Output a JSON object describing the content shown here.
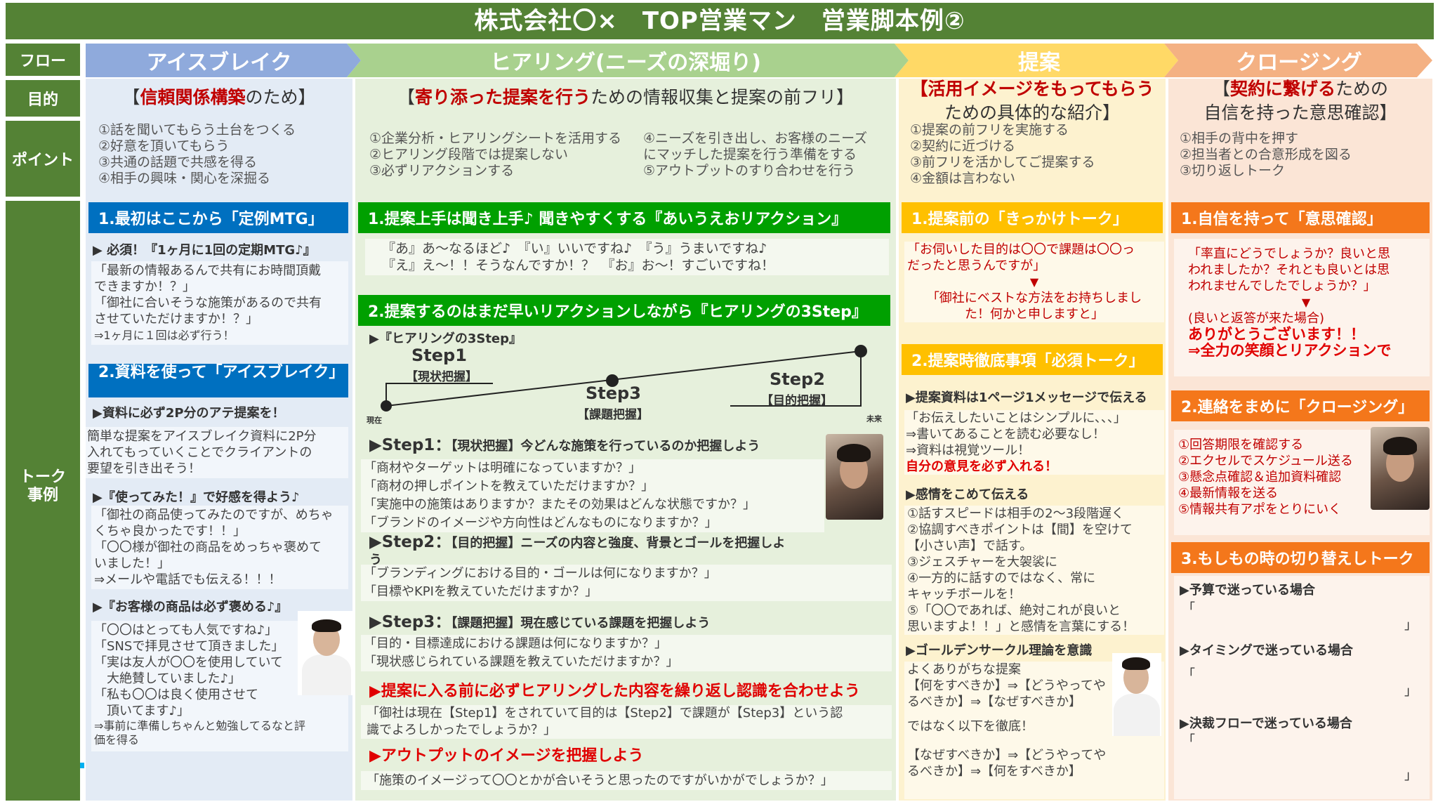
{
  "title": "株式会社〇×　TOP営業マン　営業脚本例②",
  "side_labels": {
    "flow": "フロー",
    "purpose": "目的",
    "point": "ポイント",
    "talk": "トーク\n事例"
  },
  "phases": [
    "アイスブレイク",
    "ヒアリング(ニーズの深堀り)",
    "提案",
    "クロージング"
  ],
  "purposes": {
    "ice": {
      "pre": "【",
      "red": "信頼関係構築",
      "post": "のため】"
    },
    "hear": {
      "pre": "【",
      "red": "寄り添った提案を行う",
      "post": "ための情報収集と提案の前フリ】"
    },
    "prop": {
      "red": "【活用イメージをもってもらう",
      "post": "ための具体的な紹介】"
    },
    "close": {
      "pre": "【",
      "red": "契約に繋げる",
      "post": "ための",
      "line2": "自信を持った意思確認】"
    }
  },
  "points": {
    "ice": [
      "①話を聞いてもらう土台をつくる",
      "②好意を頂いてもらう",
      "③共通の話題で共感を得る",
      "④相手の興味・関心を深掘る"
    ],
    "hear_a": [
      "①企業分析・ヒアリングシートを活用する",
      "②ヒアリング段階では提案しない",
      "③必ずリアクションする"
    ],
    "hear_b": [
      "④ニーズを引き出し、お客様のニーズ",
      "にマッチした提案を行う準備をする",
      "⑤アウトプットのすり合わせを行う"
    ],
    "prop": [
      "①提案の前フリを実施する",
      "②契約に近づける",
      "③前フリを活かしてご提案する",
      "④金額は言わない"
    ],
    "close": [
      "①相手の背中を押す",
      "②担当者との合意形成を図る",
      "③切り返しトーク"
    ]
  },
  "ice": {
    "h1": "1.最初はここから「定例MTG」",
    "s1": "▶ 必須！『1ヶ月に1回の定期MTG♪』",
    "t1": [
      "「最新の情報あるんで共有にお時間頂戴",
      "できますか！？」",
      "「御社に合いそうな施策があるので共有",
      "させていただけますか！？」"
    ],
    "t1b": "⇒1ヶ月に１回は必ず行う！",
    "h2": "2.資料を使って「アイスブレイク」",
    "s2": "▶資料に必ず2P分のアテ提案を！",
    "t2": [
      "簡単な提案をアイスブレイク資料に2P分",
      "入れてもっていくことでクライアントの",
      "要望を引き出そう！"
    ],
    "s3": "▶『使ってみた！』で好感を得よう♪",
    "t3": [
      "「御社の商品使ってみたのですが、めちゃ",
      "くちゃ良かったです！！」",
      "「〇〇様が御社の商品をめっちゃ褒めて",
      "いました！」",
      "⇒メールや電話でも伝える！！！"
    ],
    "s4": "▶『お客様の商品は必ず褒める♪』",
    "t4": [
      "「〇〇はとっても人気ですね♪」",
      "「SNSで拝見させて頂きました」",
      "「実は友人が〇〇を使用していて",
      "　大絶賛していました♪」",
      "「私も〇〇は良く使用させて",
      "　頂いてます♪」"
    ],
    "t4b": [
      "⇒事前に準備しちゃんと勉強してるなと評",
      "価を得る"
    ]
  },
  "hear": {
    "h1": "1.提案上手は聞き上手♪ 聞きやすくする『あいうえおリアクション』",
    "r1": "『あ』あ～なるほど♪　『い』いいですね♪　『う』うまいですね♪",
    "r2": "『え』え～！！そうなんですか！？　『お』お～！すごいですね！",
    "h2": "2.提案するのはまだ早いリアクションしながら『ヒアリングの3Step』",
    "s0": "▶『ヒアリングの3Step』",
    "d_step1": "Step1",
    "d_step1s": "【現状把握】",
    "d_step3": "Step3",
    "d_step3s": "【課題把握】",
    "d_step2": "Step2",
    "d_step2s": "【目的把握】",
    "d_now": "現在",
    "d_future": "未来",
    "st1": {
      "b": "▶Step1：",
      "r": "【現状把握】今どんな施策を行っているのか把握しよう"
    },
    "q1": [
      "「商材やターゲットは明確になっていますか？」",
      "「商材の押しポイントを教えていただけますか？」",
      "「実施中の施策はありますか？またその効果はどんな状態ですか？」",
      "「ブランドのイメージや方向性はどんなものになりますか？」"
    ],
    "st2": {
      "b": "▶Step2：",
      "r": "【目的把握】ニーズの内容と強度、背景とゴールを把握しよ",
      "r2": "う"
    },
    "q2": [
      "「ブランディングにおける目的・ゴールは何になりますか？」",
      "「目標やKPIを教えていただけますか？」"
    ],
    "st3": {
      "b": "▶Step3：",
      "r": "【課題把握】現在感じている課題を把握しよう"
    },
    "q3": [
      "「目的・目標達成における課題は何になりますか？」",
      "「現状感じられている課題を教えていただけますか？」"
    ],
    "red1": "▶提案に入る前に必ずヒアリングした内容を繰り返し認識を合わせよう",
    "q4": [
      "「御社は現在【Step1】をされていて目的は【Step2】で課題が【Step3】という認",
      "識でよろしかったでしょうか？」"
    ],
    "red2": "▶アウトプットのイメージを把握しよう",
    "q5": "「施策のイメージって〇〇とかが合いそうと思ったのですがいかがでしょうか？」"
  },
  "prop": {
    "h1": "1.提案前の「きっかけトーク」",
    "t1": [
      "「お伺いした目的は〇〇で課題は〇〇っ",
      "だったと思うんですが」"
    ],
    "arrow": "▼",
    "t1b": [
      "「御社にベストな方法をお持ちしまし",
      "た！何かと申しますと」"
    ],
    "h2": "2.提案時徹底事項「必須トーク」",
    "s1": "▶提案資料は1ページ1メッセージで伝える",
    "t2": [
      "「お伝えしたいことはシンプルに、、、」",
      "⇒書いてあることを読む必要なし！",
      "⇒資料は視覚ツール！"
    ],
    "t2r": "自分の意見を必ず入れる！",
    "s2": "▶感情をこめて伝える",
    "t3": [
      "①話すスピードは相手の2～3段階遅く",
      "②協調すべきポイントは【間】を空けて",
      "【小さい声】で話す。",
      "③ジェスチャーを大袈裟に",
      "④一方的に話すのではなく、常に",
      "キャッチボールを！",
      "⑤「〇〇であれば、絶対これが良いと",
      "思いますよ！！」と感情を言葉にする！"
    ],
    "s3": "▶ゴールデンサークル理論を意識",
    "t4": [
      "よくありがちな提案",
      "【何をすべきか】⇒【どうやってや",
      "るべきか】⇒【なぜすべきか】"
    ],
    "t5": "ではなく以下を徹底！",
    "t6": [
      "【なぜすべきか】⇒【どうやってや",
      "るべきか】⇒【何をすべきか】"
    ]
  },
  "close": {
    "h1": "1.自信を持って「意思確認」",
    "t1": [
      "「率直にどうでしょうか？良いと思",
      "われましたか？それとも良いとは思",
      "われませんでしたでしょうか？」"
    ],
    "arrow": "▼",
    "t1b": "(良いと返答が来た場合)",
    "r1": "ありがとうございます！！",
    "r2": "⇒全力の笑顔とリアクションで",
    "h2": "2.連絡をまめに「クロージング」",
    "t2": [
      "①回答期限を確認する",
      "②エクセルでスケジュール送る",
      "③懸念点確認＆追加資料確認",
      "④最新情報を送る",
      "⑤情報共有アポをとりにいく"
    ],
    "h3": "3.もしもの時の切り替えしトーク",
    "c1": "▶予算で迷っている場合",
    "c2": "▶タイミングで迷っている場合",
    "c3": "▶決裁フローで迷っている場合",
    "open": "「",
    "closeq": "」"
  },
  "colors": {
    "green": "#548235",
    "blue": "#0070c0",
    "brightgreen": "#00a000",
    "yellow": "#ffc000",
    "orange": "#f4771b",
    "red": "#e00000"
  }
}
